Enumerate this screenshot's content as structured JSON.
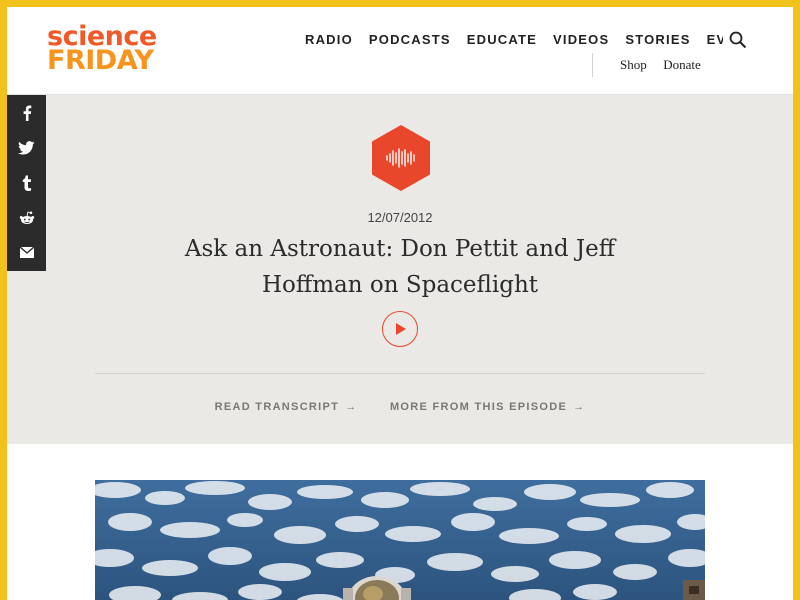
{
  "logo": {
    "line1": "science",
    "line2": "FRIDAY"
  },
  "nav": {
    "items": [
      "RADIO",
      "PODCASTS",
      "EDUCATE",
      "VIDEOS",
      "STORIES",
      "EVENTS"
    ],
    "sub": [
      "Shop",
      "Donate"
    ]
  },
  "social": {
    "icons": [
      "facebook-icon",
      "twitter-icon",
      "tumblr-icon",
      "reddit-icon",
      "email-icon"
    ]
  },
  "episode": {
    "date": "12/07/2012",
    "title": "Ask an Astronaut: Don Pettit and Jeff Hoffman on Spaceflight",
    "read_transcript": "READ TRANSCRIPT",
    "more_episode": "MORE FROM THIS EPISODE"
  },
  "colors": {
    "accent": "#e8472b",
    "logo_red": "#f05a28",
    "logo_orange": "#f7941d",
    "frame": "#f2c21c",
    "hero_bg": "#ebe9e5",
    "social_bg": "#2b2b2b"
  }
}
